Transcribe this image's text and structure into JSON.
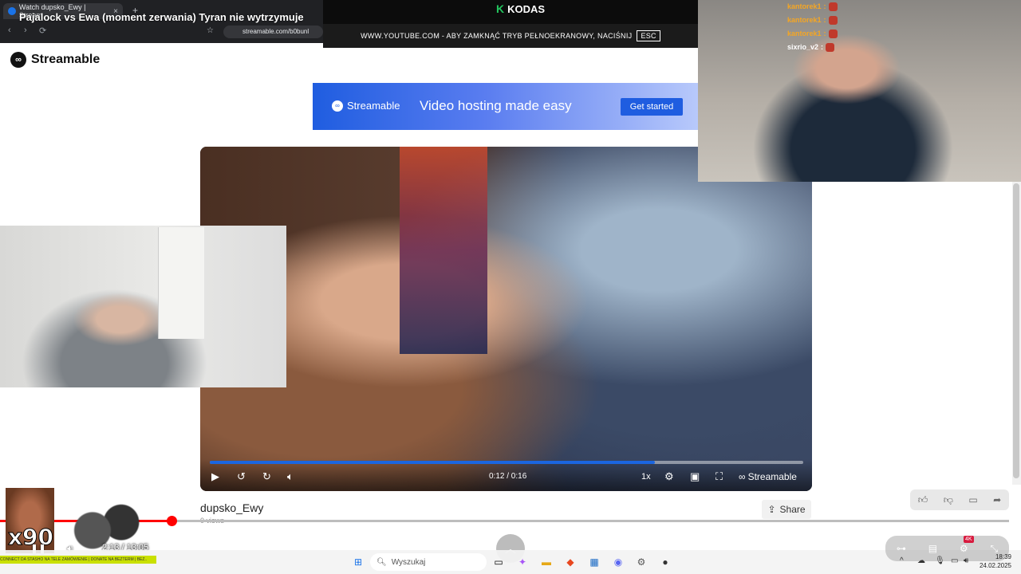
{
  "browser": {
    "tab_title": "Watch dupsko_Ewy | Stream",
    "tab_close": "×",
    "new_tab": "+",
    "url": "streamable.com/b0bunl",
    "back": "‹",
    "forward": "›",
    "reload": "⟳",
    "bookmark": "☆"
  },
  "stream": {
    "title": "Pajalock vs Ewa (moment zerwania) Tyran nie wytrzymuje",
    "channel_mark": "K",
    "channel_name": "KODAS",
    "fullscreen_notice": "WWW.YOUTUBE.COM - ABY ZAMKNĄĆ TRYB PEŁNOEKRANOWY, NACIŚNIJ",
    "esc_key": "ESC"
  },
  "chat": [
    {
      "user": "kantorek1",
      "sep": ":"
    },
    {
      "user": "kantorek1",
      "sep": ":"
    },
    {
      "user": "kantorek1",
      "sep": ":"
    },
    {
      "user": "sixrio_v2",
      "sep": ":"
    }
  ],
  "page": {
    "logo_text": "Streamable",
    "logo_icon": "infinity-icon",
    "banner": {
      "brand": "Streamable",
      "tagline": "Video hosting made easy",
      "cta": "Get started"
    },
    "video": {
      "time": "0:12 / 0:16",
      "progress": 0.75,
      "speed": "1x",
      "brand": "Streamable"
    },
    "video_title": "dupsko_Ewy",
    "views": "0 views",
    "share_label": "Share"
  },
  "overlay": {
    "multiplier": "x90",
    "time": "2:13 / 13:05",
    "progress": 0.17,
    "ticker": "CONNECT DA STASHO NA TELE ZAMÓWIENIE | DONATE NA BEZTERM | BEZ..",
    "badge": "4K"
  },
  "taskbar": {
    "search_placeholder": "Wyszukaj",
    "time": "18:39",
    "date": "24.02.2025"
  },
  "colors": {
    "accent": "#1b66e0",
    "yt_red": "#ff0000",
    "kodas_green": "#22c55e",
    "chat_user": "#f5a623"
  }
}
